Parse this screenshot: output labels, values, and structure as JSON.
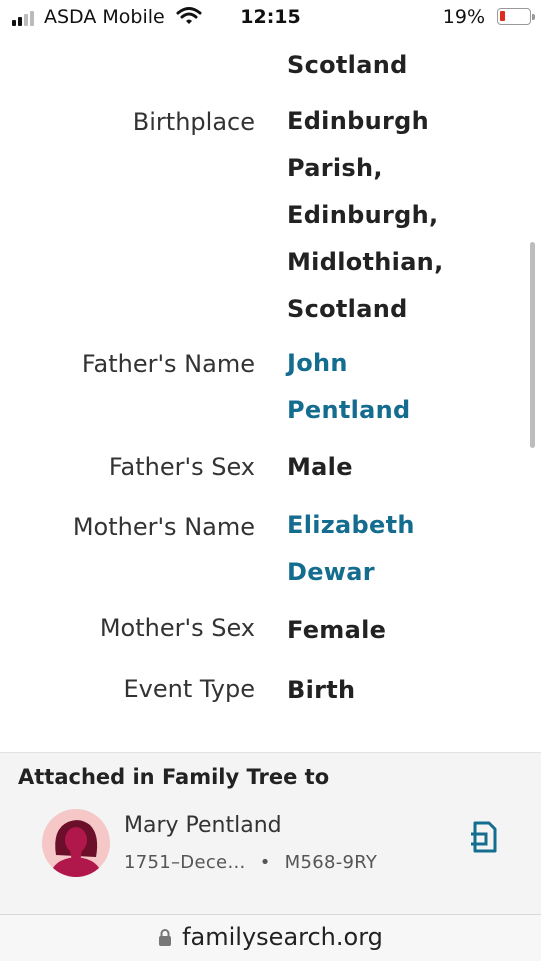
{
  "status": {
    "carrier": "ASDA Mobile",
    "time": "12:15",
    "battery_percent": "19%",
    "battery_level": 0.19,
    "battery_color": "#e0291f"
  },
  "details": {
    "top_overflow_value": "Scotland",
    "rows": [
      {
        "label": "Birthplace",
        "value": [
          "Edinburgh",
          "Parish,",
          "Edinburgh,",
          "Midlothian,",
          "Scotland"
        ],
        "link": false
      },
      {
        "label": "Father's Name",
        "value": [
          "John",
          "Pentland"
        ],
        "link": true
      },
      {
        "label": "Father's Sex",
        "value": [
          "Male"
        ],
        "link": false
      },
      {
        "label": "Mother's Name",
        "value": [
          "Elizabeth",
          "Dewar"
        ],
        "link": true
      },
      {
        "label": "Mother's Sex",
        "value": [
          "Female"
        ],
        "link": false
      },
      {
        "label": "Event Type",
        "value": [
          "Birth"
        ],
        "link": false
      }
    ],
    "link_color": "#146c8f"
  },
  "attached": {
    "title": "Attached in Family Tree to",
    "person": {
      "name": "Mary Pentland",
      "lifespan": "1751–Dece…",
      "separator": "•",
      "id": "M568-9RY",
      "avatar_icon": "female-avatar-icon"
    },
    "action_icon": "open-record-icon"
  },
  "browser": {
    "url": "familysearch.org",
    "lock_icon": "lock-icon"
  }
}
